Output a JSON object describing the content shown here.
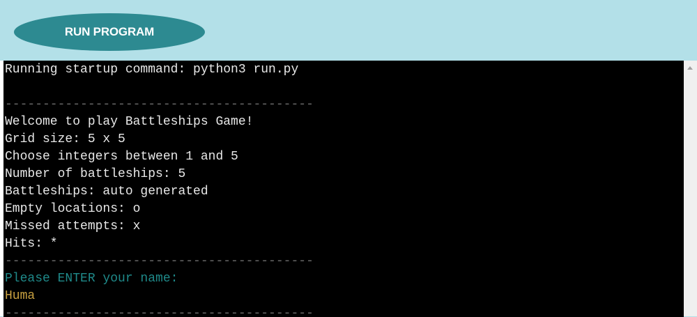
{
  "toolbar": {
    "run_label": "RUN PROGRAM"
  },
  "terminal": {
    "lines": [
      {
        "text": "Running startup command: python3 run.py",
        "style": "c-text"
      },
      {
        "text": "",
        "style": "c-text"
      },
      {
        "text": "-----------------------------------------",
        "style": "c-rule"
      },
      {
        "text": "Welcome to play Battleships Game!",
        "style": "c-text"
      },
      {
        "text": "Grid size: 5 x 5",
        "style": "c-text"
      },
      {
        "text": "Choose integers between 1 and 5",
        "style": "c-text"
      },
      {
        "text": "Number of battleships: 5",
        "style": "c-text"
      },
      {
        "text": "Battleships: auto generated",
        "style": "c-text"
      },
      {
        "text": "Empty locations: o",
        "style": "c-text"
      },
      {
        "text": "Missed attempts: x",
        "style": "c-text"
      },
      {
        "text": "Hits: *",
        "style": "c-text"
      },
      {
        "text": "-----------------------------------------",
        "style": "c-rule"
      },
      {
        "text": "Please ENTER your name:",
        "style": "c-prompt"
      },
      {
        "text": "Huma",
        "style": "c-input"
      },
      {
        "text": "-----------------------------------------",
        "style": "c-rule"
      }
    ]
  },
  "colors": {
    "page_bg": "#b3e0e8",
    "button_bg": "#2d8a91",
    "terminal_bg": "#000000",
    "prompt": "#1f8a8a",
    "input": "#c8a040"
  },
  "icons": {
    "scroll_up": "scroll-up-arrow-icon"
  }
}
